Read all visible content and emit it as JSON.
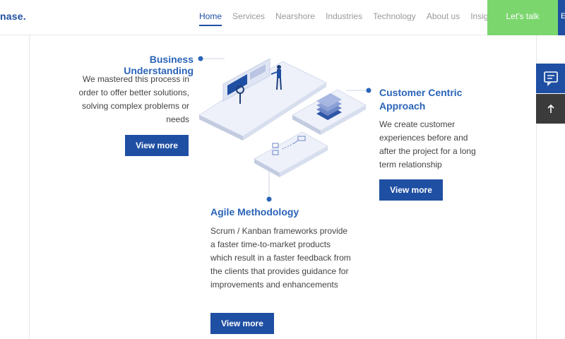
{
  "nav": {
    "logo_text": "nase",
    "logo_dot": ".",
    "links": [
      {
        "label": "Home",
        "active": true
      },
      {
        "label": "Services"
      },
      {
        "label": "Nearshore"
      },
      {
        "label": "Industries"
      },
      {
        "label": "Technology"
      },
      {
        "label": "About us"
      },
      {
        "label": "Insights"
      }
    ],
    "cta_label": "Let's talk",
    "cta2_label": "E"
  },
  "sections": {
    "business": {
      "title": "Business Understanding",
      "text": "We mastered this process in order to offer better solutions, solving complex problems or needs",
      "button": "View more"
    },
    "customer": {
      "title": "Customer Centric Approach",
      "text": "We create customer experiences before and after the project for a long term relationship",
      "button": "View more"
    },
    "agile": {
      "title": "Agile Methodology",
      "text": "Scrum / Kanban frameworks provide a faster time-to-market products which result in a faster feedback from the clients that provides guidance for improvements and enhancements",
      "button": "View more"
    }
  },
  "colors": {
    "brand_blue": "#1f4fa3",
    "accent_green": "#7bd66e",
    "title_blue": "#2a64b8"
  },
  "side_buttons": {
    "chat_icon": "chat-icon",
    "up_icon": "arrow-up-icon"
  }
}
